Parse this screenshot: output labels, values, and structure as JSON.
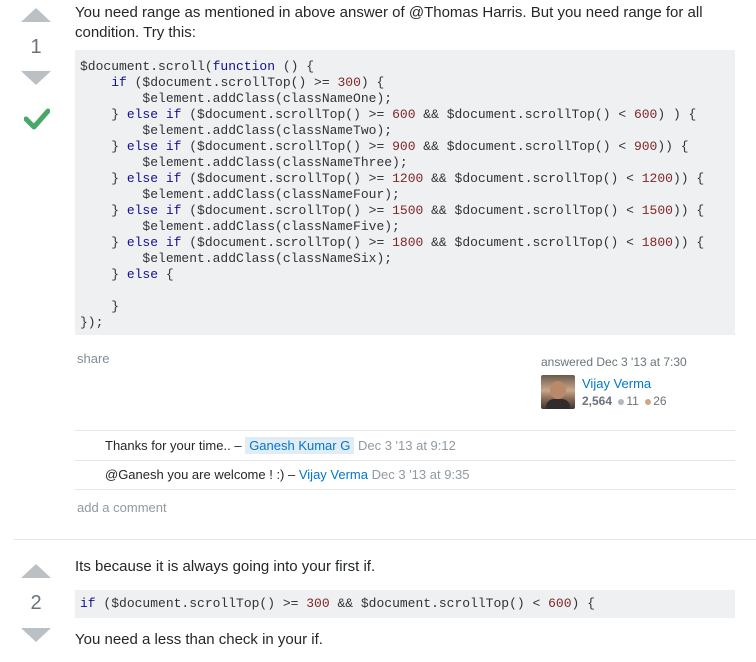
{
  "answer1": {
    "vote_count": "1",
    "accepted_icon": "checkmark-icon",
    "intro": "You need range as mentioned in above answer of @Thomas Harris. But you need range for all condition. Try this:",
    "code_lines": [
      "$document.scroll(function () {",
      "    if ($document.scrollTop() >= 300) {",
      "        $element.addClass(classNameOne);",
      "    } else if ($document.scrollTop() >= 600 && $document.scrollTop() < 600) ) {",
      "        $element.addClass(classNameTwo);",
      "    } else if ($document.scrollTop() >= 900 && $document.scrollTop() < 900)) {",
      "        $element.addClass(classNameThree);",
      "    } else if ($document.scrollTop() >= 1200 && $document.scrollTop() < 1200)) {",
      "        $element.addClass(classNameFour);",
      "    } else if ($document.scrollTop() >= 1500 && $document.scrollTop() < 1500)) {",
      "        $element.addClass(classNameFive);",
      "    } else if ($document.scrollTop() >= 1800 && $document.scrollTop() < 1800)) {",
      "        $element.addClass(classNameSix);",
      "    } else {",
      "",
      "    }",
      "});"
    ],
    "share_label": "share",
    "answered_label": "answered Dec 3 '13 at 7:30",
    "user": {
      "name": "Vijay Verma",
      "reputation": "2,564",
      "silver": "11",
      "bronze": "26",
      "silver_color": "#b4b8bc",
      "bronze_color": "#d1a684"
    },
    "comments": [
      {
        "text": "Thanks for your time.. –",
        "user": "Ganesh Kumar G",
        "date": "Dec 3 '13 at 9:12"
      },
      {
        "text": "@Ganesh you are welcome ! :) –",
        "user": "Vijay Verma",
        "date": "Dec 3 '13 at 9:35"
      }
    ],
    "add_comment_label": "add a comment"
  },
  "answer2": {
    "vote_count": "2",
    "intro": "Its because it is always going into your first if.",
    "code_line": "if ($document.scrollTop() >= 300 && $document.scrollTop() < 600) {",
    "outro": "You need a less than check in your if."
  },
  "colors": {
    "accent": "#0077cc",
    "accepted": "#48a868",
    "code_bg": "#eff0f1",
    "vote_arrow": "#bbc0c4"
  }
}
